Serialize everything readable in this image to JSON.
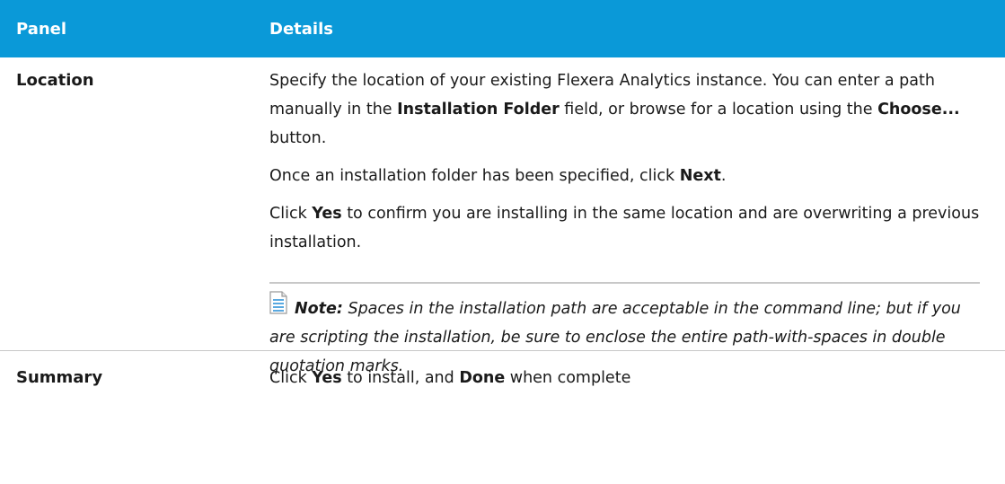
{
  "header": {
    "panel": "Panel",
    "details": "Details"
  },
  "location": {
    "name": "Location",
    "p1_a": "Specify the location of your existing Flexera Analytics instance. You can enter a path manually in the ",
    "p1_b": "Installation Folder",
    "p1_c": " field, or browse for a location using the ",
    "p1_d": "Choose...",
    "p1_e": " button.",
    "p2_a": "Once an installation folder has been specified, click ",
    "p2_b": "Next",
    "p2_c": ".",
    "p3_a": "Click ",
    "p3_b": "Yes",
    "p3_c": " to confirm you are installing in the same location and are overwriting a previous installation.",
    "note_label": "Note:",
    "note_text": " Spaces in the installation path are acceptable in the command line; but if you are scripting the installation, be sure to enclose the entire path-with-spaces in double quotation marks.",
    "note_icon": "note-document-icon"
  },
  "summary": {
    "name": "Summary",
    "t_a": "Click ",
    "t_b": "Yes",
    "t_c": " to install, and ",
    "t_d": "Done",
    "t_e": " when complete"
  },
  "colors": {
    "header_bg": "#0a99d8",
    "divider": "#c8c8c8"
  }
}
